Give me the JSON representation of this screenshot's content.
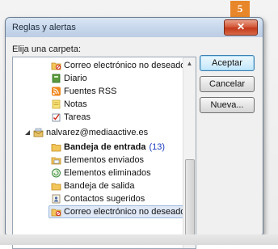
{
  "window": {
    "title": "Reglas y alertas",
    "close_label": "✕",
    "step_badge": "5"
  },
  "prompt": "Elija una carpeta:",
  "tree": {
    "items": [
      {
        "label": "Correo electrónico no deseado",
        "icon": "junk-mail-folder-icon"
      },
      {
        "label": "Diario",
        "icon": "journal-icon"
      },
      {
        "label": "Fuentes RSS",
        "icon": "rss-feeds-icon"
      },
      {
        "label": "Notas",
        "icon": "notes-icon"
      },
      {
        "label": "Tareas",
        "icon": "tasks-icon"
      },
      {
        "label": "nalvarez@mediaactive.es",
        "icon": "mailbox-account-icon"
      },
      {
        "label": "Bandeja de entrada",
        "icon": "inbox-folder-icon",
        "count": "(13)"
      },
      {
        "label": "Elementos enviados",
        "icon": "sent-items-icon"
      },
      {
        "label": "Elementos eliminados",
        "icon": "deleted-items-icon"
      },
      {
        "label": "Bandeja de salida",
        "icon": "outbox-icon"
      },
      {
        "label": "Contactos sugeridos",
        "icon": "suggested-contacts-icon"
      },
      {
        "label": "Correo electrónico no deseado",
        "icon": "junk-mail-folder-icon"
      }
    ]
  },
  "buttons": {
    "accept": "Aceptar",
    "cancel": "Cancelar",
    "new": "Nueva..."
  },
  "colors": {
    "accent": "#3c7fb1",
    "badge": "#e8872a",
    "count": "#1a3cc0"
  }
}
